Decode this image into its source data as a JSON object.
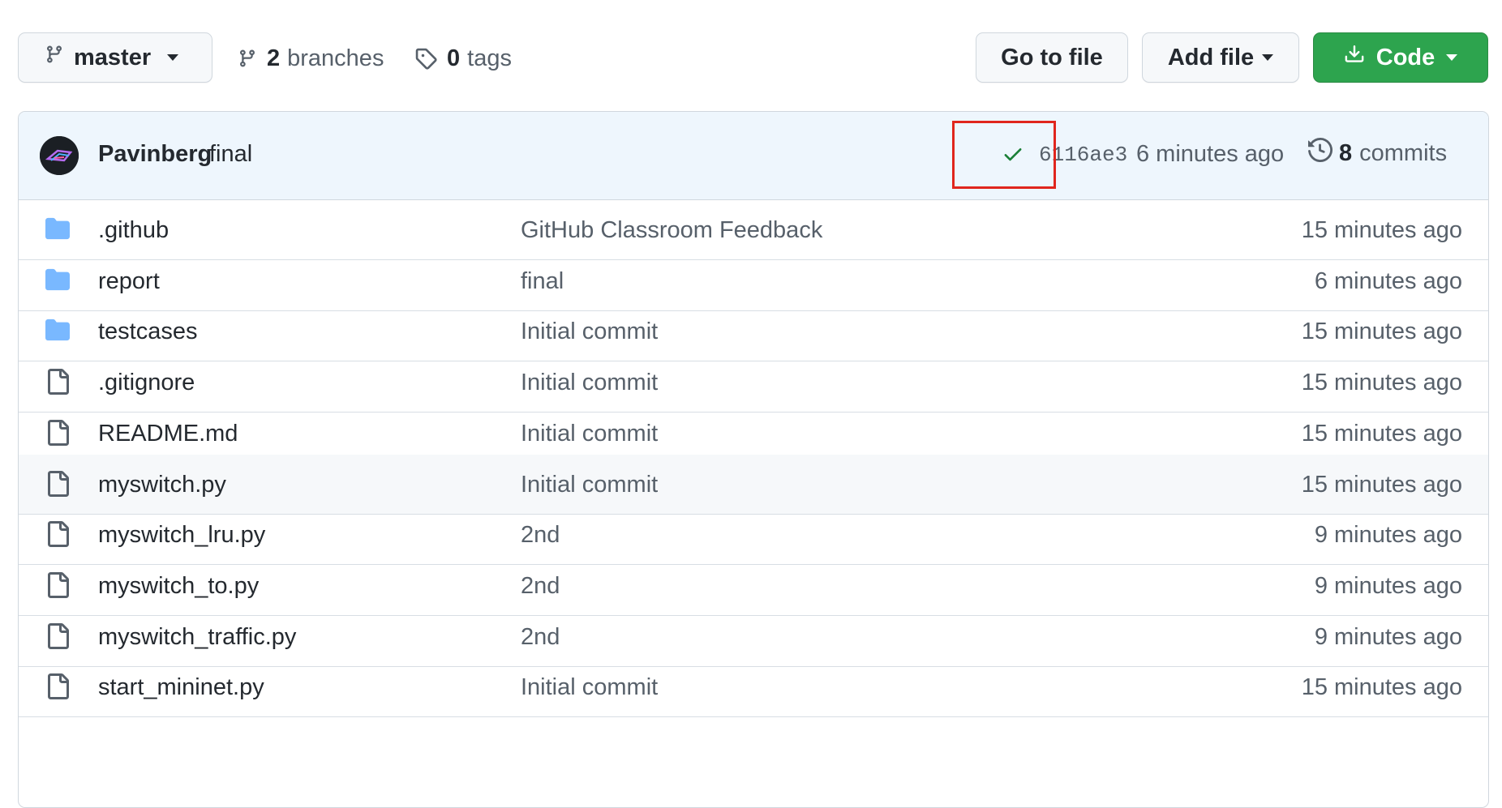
{
  "toolbar": {
    "branch_name": "master",
    "branches_count": "2",
    "branches_label": "branches",
    "tags_count": "0",
    "tags_label": "tags",
    "go_to_file_label": "Go to file",
    "add_file_label": "Add file",
    "code_label": "Code"
  },
  "commit": {
    "author": "Pavinberg",
    "message": "final",
    "status_icon": "check-icon",
    "sha": "6116ae3",
    "time": "6 minutes ago",
    "commits_count": "8",
    "commits_label": "commits"
  },
  "files": [
    {
      "type": "folder",
      "name": ".github",
      "commit": "GitHub Classroom Feedback",
      "age": "15 minutes ago"
    },
    {
      "type": "folder",
      "name": "report",
      "commit": "final",
      "age": "6 minutes ago"
    },
    {
      "type": "folder",
      "name": "testcases",
      "commit": "Initial commit",
      "age": "15 minutes ago"
    },
    {
      "type": "file",
      "name": ".gitignore",
      "commit": "Initial commit",
      "age": "15 minutes ago"
    },
    {
      "type": "file",
      "name": "README.md",
      "commit": "Initial commit",
      "age": "15 minutes ago"
    },
    {
      "type": "file",
      "name": "myswitch.py",
      "commit": "Initial commit",
      "age": "15 minutes ago"
    },
    {
      "type": "file",
      "name": "myswitch_lru.py",
      "commit": "2nd",
      "age": "9 minutes ago"
    },
    {
      "type": "file",
      "name": "myswitch_to.py",
      "commit": "2nd",
      "age": "9 minutes ago"
    },
    {
      "type": "file",
      "name": "myswitch_traffic.py",
      "commit": "2nd",
      "age": "9 minutes ago"
    },
    {
      "type": "file",
      "name": "start_mininet.py",
      "commit": "Initial commit",
      "age": "15 minutes ago"
    }
  ],
  "colors": {
    "folder": "#79b8ff",
    "code_button": "#2da44e",
    "check": "#1a7f37",
    "highlight": "#e0261d"
  }
}
